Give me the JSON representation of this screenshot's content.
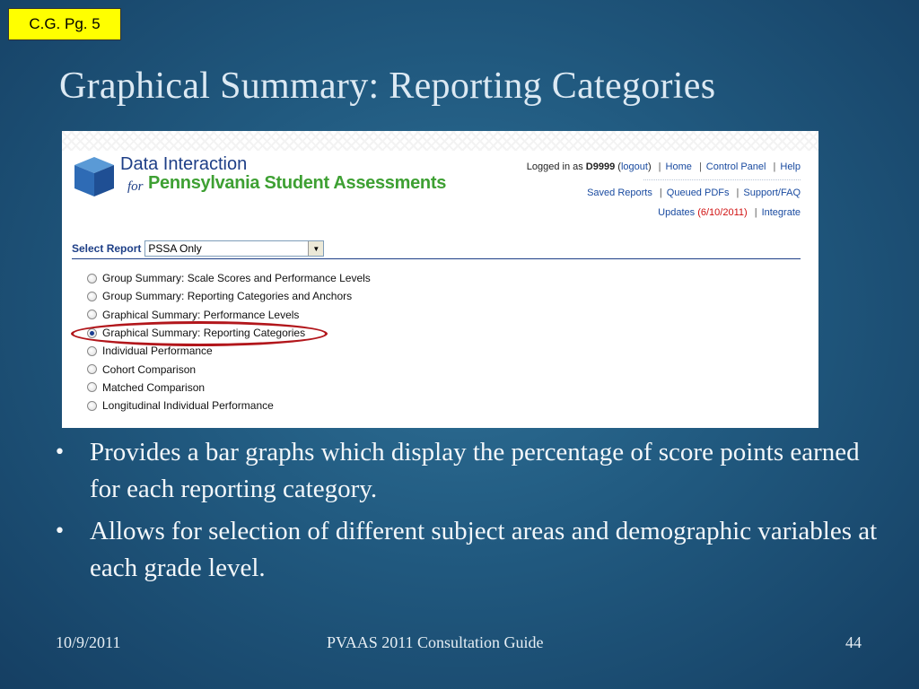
{
  "page_tag": "C.G. Pg. 5",
  "slide_title": "Graphical Summary: Reporting Categories",
  "screenshot": {
    "brand_line1": "Data Interaction",
    "brand_for": "for",
    "brand_line2": "Pennsylvania Student Assessments",
    "logged_in_prefix": "Logged in as",
    "user_id": "D9999",
    "logout": "logout",
    "home": "Home",
    "control_panel": "Control Panel",
    "help": "Help",
    "saved_reports": "Saved Reports",
    "queued_pdfs": "Queued PDFs",
    "support_faq": "Support/FAQ",
    "updates": "Updates",
    "updates_date": "(6/10/2011)",
    "integrate": "Integrate",
    "select_report_label": "Select Report",
    "select_report_value": "PSSA Only",
    "report_options": [
      "Group Summary: Scale Scores and Performance Levels",
      "Group Summary: Reporting Categories and Anchors",
      "Graphical Summary: Performance Levels",
      "Graphical Summary: Reporting Categories",
      "Individual Performance",
      "Cohort Comparison",
      "Matched Comparison",
      "Longitudinal Individual Performance"
    ],
    "selected_option": "Graphical Summary: Reporting Categories"
  },
  "bullets": [
    "Provides a bar graphs which display the percentage of score points earned for each reporting category.",
    "Allows for selection of different subject areas and demographic variables at each grade level."
  ],
  "footer": {
    "date": "10/9/2011",
    "center": "PVAAS 2011 Consultation Guide",
    "page": "44"
  },
  "colors": {
    "background": "#215a80",
    "tag": "#ffff00",
    "brand_blue": "#1e3f87",
    "brand_green": "#3ea033",
    "highlight": "#b2161b"
  }
}
